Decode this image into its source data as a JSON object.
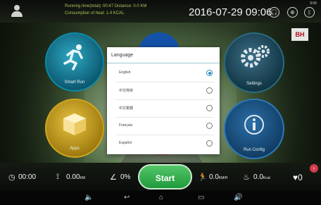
{
  "topbar": {
    "running_time_label": "Running time(total):",
    "running_time_value": "00:47",
    "distance_label": "Distance:",
    "distance_value": "0.0 KM",
    "calorie_label": "Consumption of heat:",
    "calorie_value": "1.4 KCAL",
    "datetime": "2016-07-29 09:06",
    "status_text": "9:06"
  },
  "brand": "BH",
  "tiles": {
    "smart_run": "Smart Run",
    "apps": "Apps",
    "settings": "Settings",
    "run_config": "Run Config"
  },
  "dialog": {
    "title": "Language",
    "options": [
      {
        "label": "English",
        "selected": true
      },
      {
        "label": "中文简体",
        "selected": false
      },
      {
        "label": "中文繁體",
        "selected": false
      },
      {
        "label": "Français",
        "selected": false
      },
      {
        "label": "Español",
        "selected": false
      }
    ]
  },
  "bottombar": {
    "time": "00:00",
    "distance": "0.00",
    "distance_unit": "KM",
    "incline": "0%",
    "start_label": "Start",
    "speed": "0.0",
    "speed_unit": "KM/H",
    "calories": "0.0",
    "calories_unit": "Kcal",
    "heart_rate": "0"
  },
  "icons": {
    "user": "user-icon",
    "timer": "clock-icon",
    "distance": "route-icon",
    "incline": "incline-icon",
    "speed": "runner-icon",
    "calories": "flame-icon",
    "heart": "heart-icon"
  },
  "colors": {
    "accent_green": "#1f9a3b",
    "stat_text": "#a7c35a",
    "radio_checked": "#2a8cbf"
  }
}
